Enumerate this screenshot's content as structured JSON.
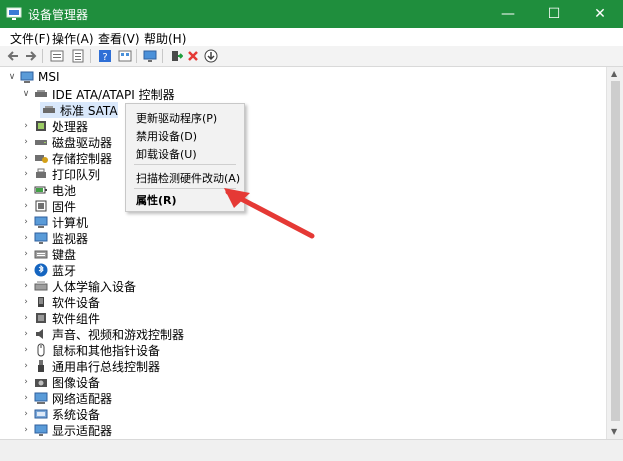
{
  "window": {
    "title": "设备管理器",
    "colors": {
      "title_bg": "#1f8e3d",
      "accent_red": "#e53935"
    }
  },
  "controls": {
    "minimize": "—",
    "maximize": "☐",
    "close": "✕"
  },
  "menu": [
    "文件(F)",
    "操作(A)",
    "查看(V)",
    "帮助(H)"
  ],
  "toolbar": [
    "back-arrow-icon",
    "forward-arrow-icon",
    "properties-icon",
    "list-icon",
    "help-icon",
    "view-icon",
    "monitor-icon",
    "update-driver-icon",
    "uninstall-icon",
    "download-icon"
  ],
  "tree": {
    "root": "MSI",
    "ide_group": "IDE ATA/ATAPI 控制器",
    "ide_child": "标准 SATA",
    "categories": [
      "处理器",
      "磁盘驱动器",
      "存储控制器",
      "打印队列",
      "电池",
      "固件",
      "计算机",
      "监视器",
      "键盘",
      "蓝牙",
      "人体学输入设备",
      "软件设备",
      "软件组件",
      "声音、视频和游戏控制器",
      "鼠标和其他指针设备",
      "通用串行总线控制器",
      "图像设备",
      "网络适配器",
      "系统设备",
      "显示适配器"
    ]
  },
  "context_menu": {
    "items": [
      "更新驱动程序(P)",
      "禁用设备(D)",
      "卸载设备(U)",
      "扫描检测硬件改动(A)",
      "属性(R)"
    ]
  }
}
